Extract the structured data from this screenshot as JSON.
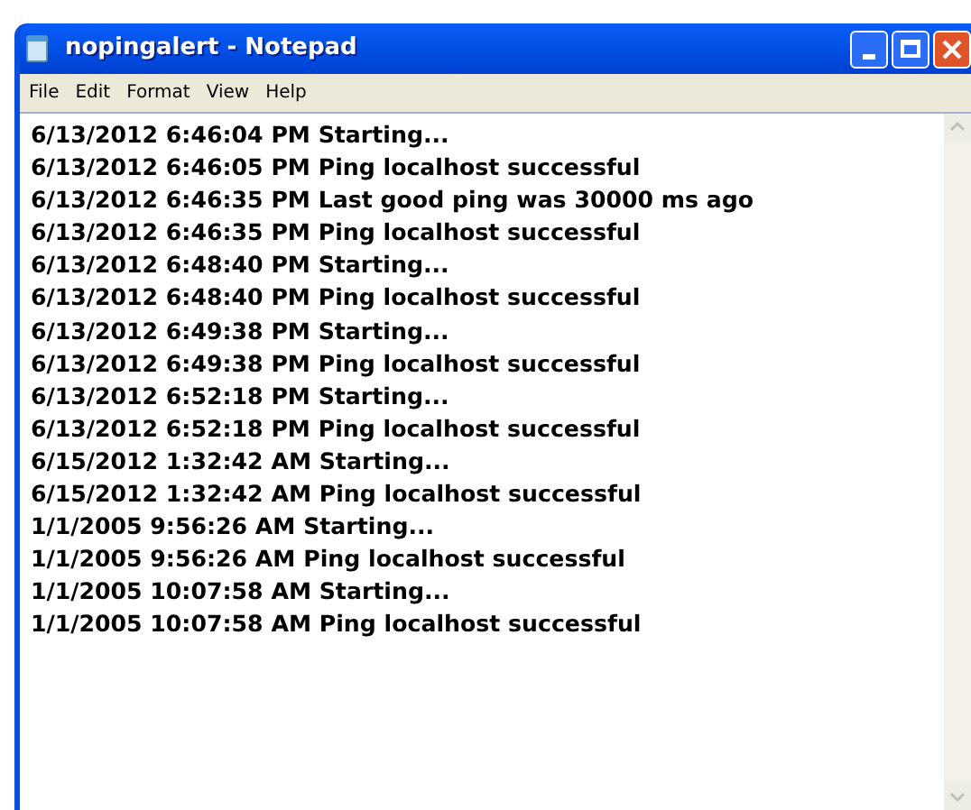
{
  "window": {
    "title": "nopingalert - Notepad"
  },
  "menu": [
    "File",
    "Edit",
    "Format",
    "View",
    "Help"
  ],
  "lines": [
    "6/13/2012 6:46:04 PM Starting...",
    "6/13/2012 6:46:05 PM Ping localhost successful",
    "6/13/2012 6:46:35 PM Last good ping was 30000 ms ago",
    "6/13/2012 6:46:35 PM Ping localhost successful",
    "6/13/2012 6:48:40 PM Starting...",
    "6/13/2012 6:48:40 PM Ping localhost successful",
    "6/13/2012 6:49:38 PM Starting...",
    "6/13/2012 6:49:38 PM Ping localhost successful",
    "6/13/2012 6:52:18 PM Starting...",
    "6/13/2012 6:52:18 PM Ping localhost successful",
    "6/15/2012 1:32:42 AM Starting...",
    "6/15/2012 1:32:42 AM Ping localhost successful",
    "1/1/2005 9:56:26 AM Starting...",
    "1/1/2005 9:56:26 AM Ping localhost successful",
    "1/1/2005 10:07:58 AM Starting...",
    "1/1/2005 10:07:58 AM Ping localhost successful"
  ]
}
